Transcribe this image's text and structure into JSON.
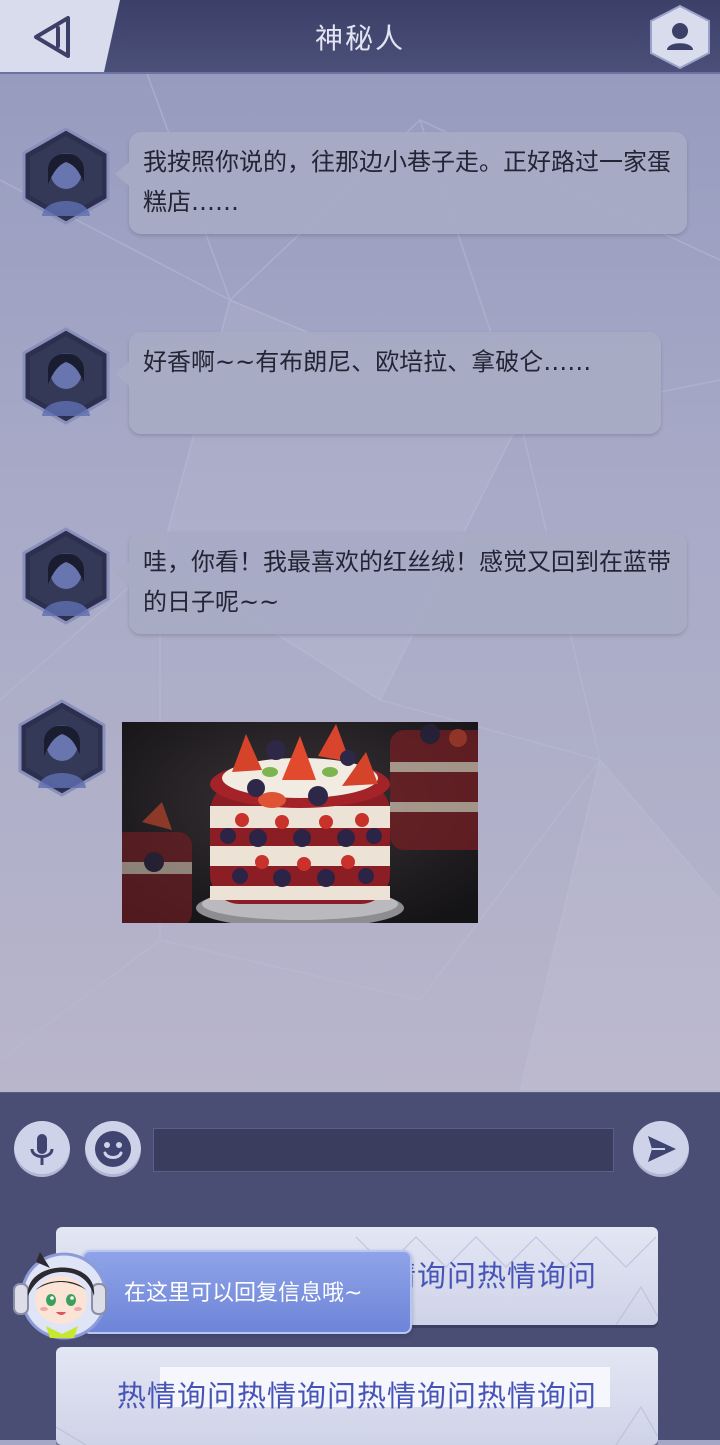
{
  "header": {
    "title": "神秘人"
  },
  "messages": [
    {
      "type": "text",
      "text": "我按照你说的，往那边小巷子走。正好路过一家蛋糕店……"
    },
    {
      "type": "text",
      "text": "好香啊~~有布朗尼、欧培拉、拿破仑……"
    },
    {
      "type": "text",
      "text": "哇，你看！我最喜欢的红丝绒！感觉又回到在蓝带的日子呢~~"
    },
    {
      "type": "image",
      "image": "red-velvet-cake-photo"
    }
  ],
  "input": {
    "value": "",
    "placeholder": ""
  },
  "icons": {
    "back": "back-arrow-icon",
    "profile": "user-icon",
    "voice": "microphone-icon",
    "emoji": "smiley-icon",
    "send": "send-icon"
  },
  "quick_replies": [
    {
      "label": "热情询问热情询问热情询问热情询问"
    },
    {
      "label": "热情询问热情询问热情询问热情询问"
    }
  ],
  "tooltip": {
    "text": "在这里可以回复信息哦~"
  },
  "colors": {
    "header_bg": "#3c4068",
    "bubble_bg": "#a8abc4",
    "input_bar_bg": "#4a4e74",
    "quick_reply_text": "#4654b8",
    "tooltip_bg": "#7b91df"
  }
}
